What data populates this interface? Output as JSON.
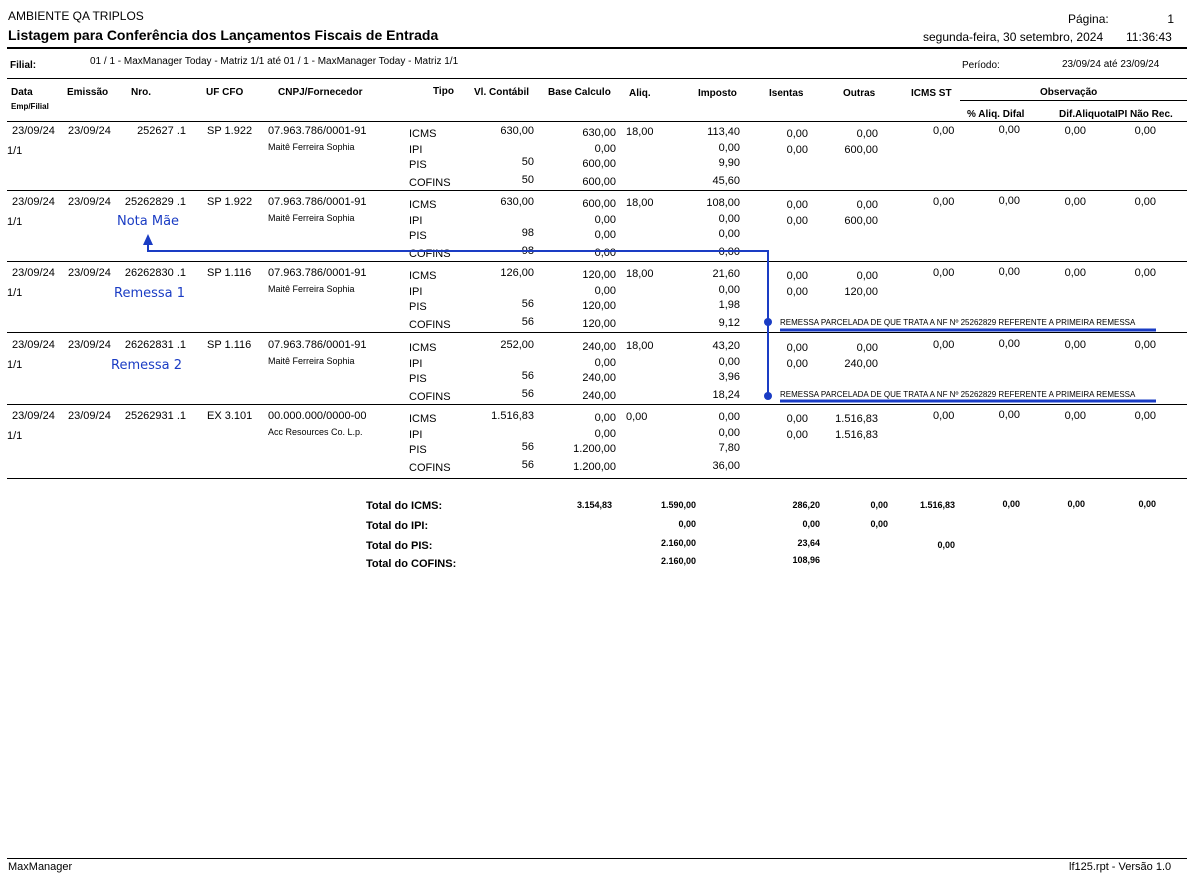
{
  "header": {
    "env": "AMBIENTE QA TRIPLOS",
    "title": "Listagem para Conferência dos Lançamentos Fiscais de Entrada",
    "page_label": "Página:",
    "page_num": "1",
    "date": "segunda-feira, 30 setembro, 2024",
    "time": "11:36:43",
    "filial_label": "Filial:",
    "filial_value": "01 / 1 - MaxManager Today - Matriz 1/1 até 01 / 1 - MaxManager Today - Matriz 1/1",
    "periodo_label": "Período:",
    "periodo_value": "23/09/24  até  23/09/24"
  },
  "columns": {
    "data": "Data",
    "emp_filial": "Emp/Filial",
    "emissao": "Emissão",
    "nro": "Nro.",
    "uf_cfo": "UF  CFO",
    "cnpj": "CNPJ/Fornecedor",
    "tipo": "Tipo",
    "vl_contabil": "Vl. Contábil",
    "base_calculo": "Base Calculo",
    "aliq": "Aliq.",
    "imposto": "Imposto",
    "isentas": "Isentas",
    "outras": "Outras",
    "icms_st": "ICMS ST",
    "observacao": "Observação",
    "aliq_difal": "% Aliq. Difal",
    "dif_aliquota": "Dif.Aliquota",
    "ipi_nao_rec": "IPI Não Rec."
  },
  "records": [
    {
      "data": "23/09/24",
      "emp": "1/1",
      "emissao": "23/09/24",
      "nro": "252627 .1",
      "uf_cfo": "SP 1.922",
      "cnpj": "07.963.786/0001-91",
      "fornecedor": "Maitê Ferreira Sophia",
      "difal": "0,00",
      "dif_aliq": "0,00",
      "ipi_nao_rec": "0,00",
      "icms_st": "0,00",
      "lines": [
        {
          "tipo": "ICMS",
          "vl": "630,00",
          "base": "630,00",
          "aliq": "18,00",
          "imposto": "113,40",
          "isentas": "0,00",
          "outras": "0,00"
        },
        {
          "tipo": "IPI",
          "vl": "",
          "base": "0,00",
          "aliq": "",
          "imposto": "0,00",
          "isentas": "0,00",
          "outras": "600,00"
        },
        {
          "tipo": "PIS",
          "vl": "50",
          "base": "600,00",
          "aliq": "",
          "imposto": "9,90",
          "isentas": "",
          "outras": ""
        },
        {
          "tipo": "COFINS",
          "vl": "50",
          "base": "600,00",
          "aliq": "",
          "imposto": "45,60",
          "isentas": "",
          "outras": ""
        }
      ],
      "annotation": "",
      "obs": ""
    },
    {
      "data": "23/09/24",
      "emp": "1/1",
      "emissao": "23/09/24",
      "nro": "25262829 .1",
      "uf_cfo": "SP 1.922",
      "cnpj": "07.963.786/0001-91",
      "fornecedor": "Maitê Ferreira Sophia",
      "difal": "0,00",
      "dif_aliq": "0,00",
      "ipi_nao_rec": "0,00",
      "icms_st": "0,00",
      "lines": [
        {
          "tipo": "ICMS",
          "vl": "630,00",
          "base": "600,00",
          "aliq": "18,00",
          "imposto": "108,00",
          "isentas": "0,00",
          "outras": "0,00"
        },
        {
          "tipo": "IPI",
          "vl": "",
          "base": "0,00",
          "aliq": "",
          "imposto": "0,00",
          "isentas": "0,00",
          "outras": "600,00"
        },
        {
          "tipo": "PIS",
          "vl": "98",
          "base": "0,00",
          "aliq": "",
          "imposto": "0,00",
          "isentas": "",
          "outras": ""
        },
        {
          "tipo": "COFINS",
          "vl": "98",
          "base": "0,00",
          "aliq": "",
          "imposto": "0,00",
          "isentas": "",
          "outras": ""
        }
      ],
      "annotation": "Nota Mãe",
      "obs": ""
    },
    {
      "data": "23/09/24",
      "emp": "1/1",
      "emissao": "23/09/24",
      "nro": "26262830 .1",
      "uf_cfo": "SP 1.116",
      "cnpj": "07.963.786/0001-91",
      "fornecedor": "Maitê Ferreira Sophia",
      "difal": "0,00",
      "dif_aliq": "0,00",
      "ipi_nao_rec": "0,00",
      "icms_st": "0,00",
      "lines": [
        {
          "tipo": "ICMS",
          "vl": "126,00",
          "base": "120,00",
          "aliq": "18,00",
          "imposto": "21,60",
          "isentas": "0,00",
          "outras": "0,00"
        },
        {
          "tipo": "IPI",
          "vl": "",
          "base": "0,00",
          "aliq": "",
          "imposto": "0,00",
          "isentas": "0,00",
          "outras": "120,00"
        },
        {
          "tipo": "PIS",
          "vl": "56",
          "base": "120,00",
          "aliq": "",
          "imposto": "1,98",
          "isentas": "",
          "outras": ""
        },
        {
          "tipo": "COFINS",
          "vl": "56",
          "base": "120,00",
          "aliq": "",
          "imposto": "9,12",
          "isentas": "",
          "outras": ""
        }
      ],
      "annotation": "Remessa 1",
      "obs": "REMESSA PARCELADA DE QUE TRATA A NF Nº 25262829 REFERENTE A PRIMEIRA REMESSA"
    },
    {
      "data": "23/09/24",
      "emp": "1/1",
      "emissao": "23/09/24",
      "nro": "26262831 .1",
      "uf_cfo": "SP 1.116",
      "cnpj": "07.963.786/0001-91",
      "fornecedor": "Maitê Ferreira Sophia",
      "difal": "0,00",
      "dif_aliq": "0,00",
      "ipi_nao_rec": "0,00",
      "icms_st": "0,00",
      "lines": [
        {
          "tipo": "ICMS",
          "vl": "252,00",
          "base": "240,00",
          "aliq": "18,00",
          "imposto": "43,20",
          "isentas": "0,00",
          "outras": "0,00"
        },
        {
          "tipo": "IPI",
          "vl": "",
          "base": "0,00",
          "aliq": "",
          "imposto": "0,00",
          "isentas": "0,00",
          "outras": "240,00"
        },
        {
          "tipo": "PIS",
          "vl": "56",
          "base": "240,00",
          "aliq": "",
          "imposto": "3,96",
          "isentas": "",
          "outras": ""
        },
        {
          "tipo": "COFINS",
          "vl": "56",
          "base": "240,00",
          "aliq": "",
          "imposto": "18,24",
          "isentas": "",
          "outras": ""
        }
      ],
      "annotation": "Remessa 2",
      "obs": "REMESSA PARCELADA DE QUE TRATA A NF Nº 25262829 REFERENTE A PRIMEIRA REMESSA"
    },
    {
      "data": "23/09/24",
      "emp": "1/1",
      "emissao": "23/09/24",
      "nro": "25262931 .1",
      "uf_cfo": "EX 3.101",
      "cnpj": "00.000.000/0000-00",
      "fornecedor": "Acc Resources Co. L.p.",
      "difal": "0,00",
      "dif_aliq": "0,00",
      "ipi_nao_rec": "0,00",
      "icms_st": "0,00",
      "lines": [
        {
          "tipo": "ICMS",
          "vl": "1.516,83",
          "base": "0,00",
          "aliq": "0,00",
          "imposto": "0,00",
          "isentas": "0,00",
          "outras": "1.516,83"
        },
        {
          "tipo": "IPI",
          "vl": "",
          "base": "0,00",
          "aliq": "",
          "imposto": "0,00",
          "isentas": "0,00",
          "outras": "1.516,83"
        },
        {
          "tipo": "PIS",
          "vl": "56",
          "base": "1.200,00",
          "aliq": "",
          "imposto": "7,80",
          "isentas": "",
          "outras": ""
        },
        {
          "tipo": "COFINS",
          "vl": "56",
          "base": "1.200,00",
          "aliq": "",
          "imposto": "36,00",
          "isentas": "",
          "outras": ""
        }
      ],
      "annotation": "",
      "obs": ""
    }
  ],
  "totals": {
    "icms_label": "Total do ICMS:",
    "icms_vl": "3.154,83",
    "icms_base": "1.590,00",
    "icms_imposto": "286,20",
    "icms_isentas": "0,00",
    "icms_outras": "1.516,83",
    "icms_difal": "0,00",
    "icms_dif_aliq": "0,00",
    "icms_ipi_nao_rec": "0,00",
    "ipi_label": "Total do IPI:",
    "ipi_base": "0,00",
    "ipi_imposto": "0,00",
    "ipi_isentas": "0,00",
    "pis_label": "Total do PIS:",
    "pis_base": "2.160,00",
    "pis_imposto": "23,64",
    "pis_outras": "0,00",
    "cofins_label": "Total do COFINS:",
    "cofins_base": "2.160,00",
    "cofins_imposto": "108,96"
  },
  "footer": {
    "left": "MaxManager",
    "right": "lf125.rpt  -  Versão 1.0"
  },
  "colors": {
    "annotation": "#1a3cc4"
  }
}
